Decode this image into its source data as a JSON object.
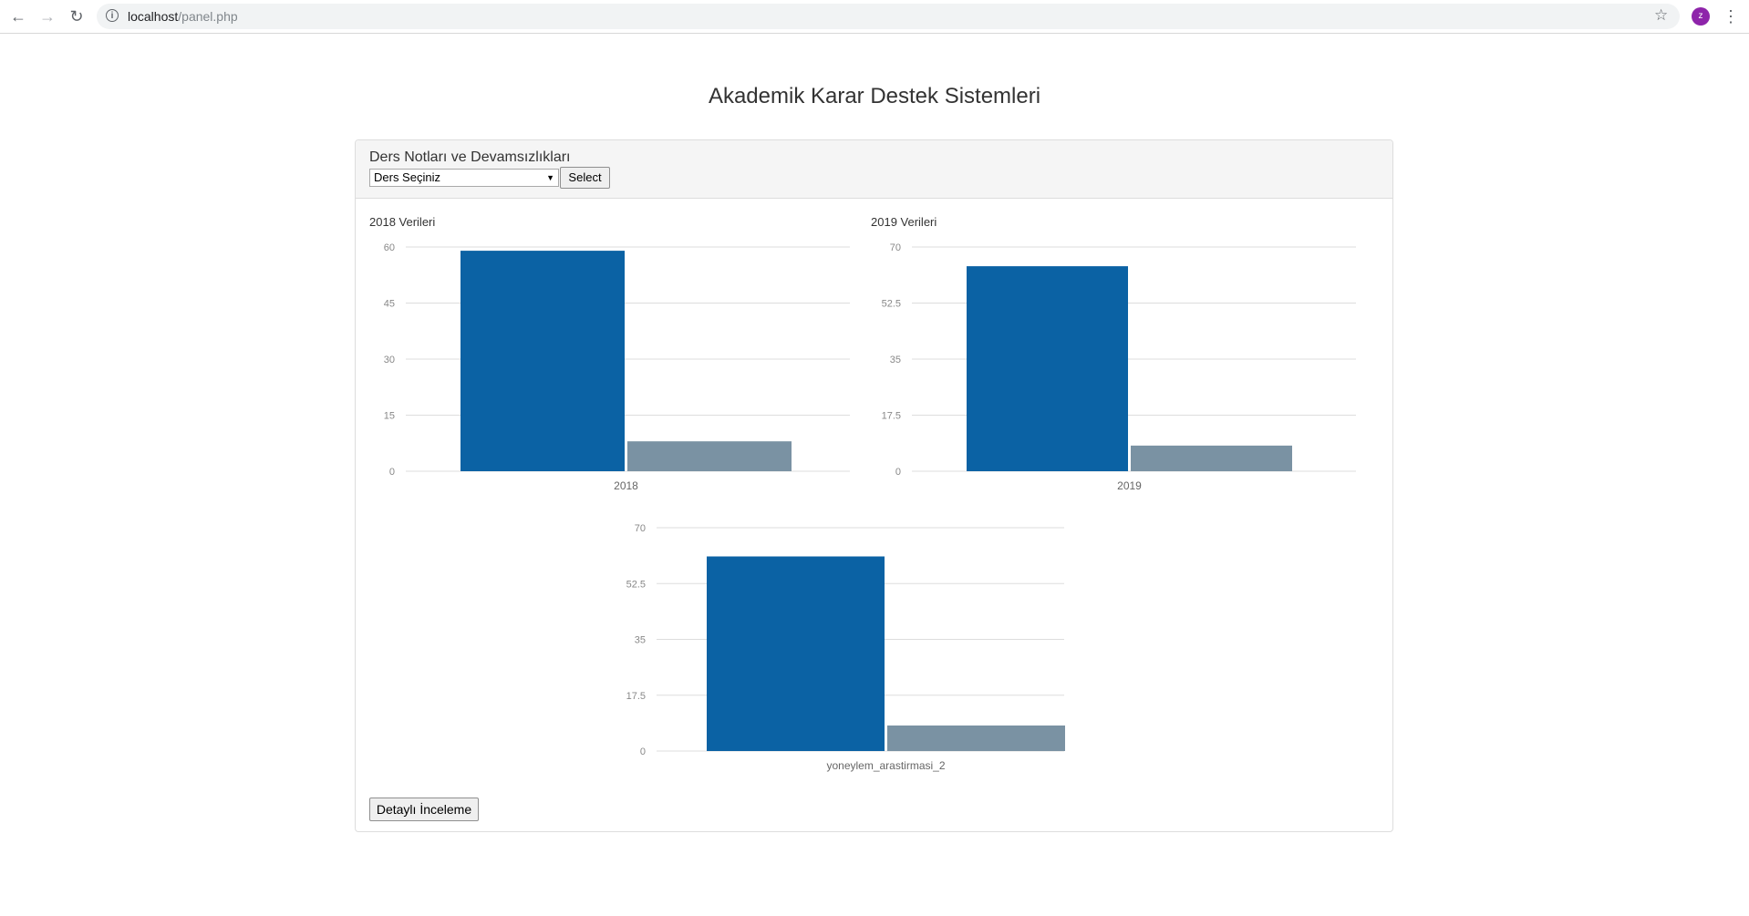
{
  "browser": {
    "url_host": "localhost",
    "url_path": "/panel.php",
    "avatar_letter": "z"
  },
  "page": {
    "title": "Akademik Karar Destek Sistemleri"
  },
  "panel": {
    "heading": "Ders Notları ve Devamsızlıkları",
    "select_value": "Ders Seçiniz",
    "select_button": "Select",
    "detail_button": "Detaylı İnceleme"
  },
  "colors": {
    "series1": "#0b62a4",
    "series2": "#7a92a3",
    "grid": "#dddddd"
  },
  "chart_data": [
    {
      "type": "bar",
      "title": "2018 Verileri",
      "categories": [
        "2018"
      ],
      "yticks": [
        "60",
        "45",
        "30",
        "15",
        "0"
      ],
      "ylim": [
        0,
        60
      ],
      "series": [
        {
          "values": [
            59
          ]
        },
        {
          "values": [
            8
          ]
        }
      ]
    },
    {
      "type": "bar",
      "title": "2019 Verileri",
      "categories": [
        "2019"
      ],
      "yticks": [
        "70",
        "52.5",
        "35",
        "17.5",
        "0"
      ],
      "ylim": [
        0,
        70
      ],
      "series": [
        {
          "values": [
            64
          ]
        },
        {
          "values": [
            8
          ]
        }
      ]
    },
    {
      "type": "bar",
      "title": "",
      "categories": [
        "yoneylem_arastirmasi_2"
      ],
      "yticks": [
        "70",
        "52.5",
        "35",
        "17.5",
        "0"
      ],
      "ylim": [
        0,
        70
      ],
      "series": [
        {
          "values": [
            61
          ]
        },
        {
          "values": [
            8
          ]
        }
      ]
    }
  ]
}
